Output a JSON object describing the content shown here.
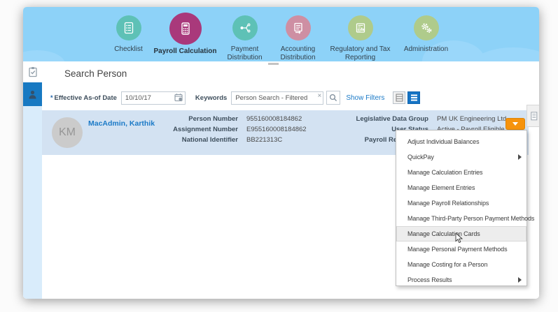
{
  "colors": {
    "header_blue": "#8DD2F8",
    "row_blue": "#D3E2F2",
    "accent_orange": "#F6930D",
    "link_blue": "#1B7AC7",
    "active_tile_blue": "#1779C2",
    "teal_circle": "#5EC1B6",
    "magenta_circle": "#A9397B",
    "pink_circle": "#CE8FA3",
    "green_circle": "#AFCB8B"
  },
  "nav": {
    "items": [
      {
        "label": "Checklist",
        "icon": "checklist-icon",
        "selected": false
      },
      {
        "label": "Payroll Calculation",
        "icon": "calculator-icon",
        "selected": true
      },
      {
        "label": "Payment Distribution",
        "icon": "payment-distribution-icon",
        "selected": false
      },
      {
        "label": "Accounting Distribution",
        "icon": "accounting-distribution-icon",
        "selected": false
      },
      {
        "label": "Regulatory and Tax Reporting",
        "icon": "regulatory-report-icon",
        "selected": false
      },
      {
        "label": "Administration",
        "icon": "gears-icon",
        "selected": false
      }
    ]
  },
  "sidebar": {
    "items": [
      {
        "icon": "tasks-clipboard-icon",
        "active": false
      },
      {
        "icon": "person-icon",
        "active": true
      }
    ]
  },
  "page": {
    "title": "Search Person"
  },
  "search": {
    "date_required_marker": "*",
    "date_label": "Effective As-of Date",
    "date_value": "10/10/17",
    "keywords_label": "Keywords",
    "keywords_value": "Person Search - Filtered",
    "clear_glyph": "×",
    "show_filters_label": "Show Filters"
  },
  "person": {
    "initials": "KM",
    "name": "MacAdmin, Karthik",
    "left_fields": [
      {
        "label": "Person Number",
        "value": "955160008184862"
      },
      {
        "label": "Assignment Number",
        "value": "E955160008184862"
      },
      {
        "label": "National Identifier",
        "value": "BB221313C"
      }
    ],
    "right_fields": [
      {
        "label": "Legislative Data Group",
        "value": "PM UK Engineering Ltd"
      },
      {
        "label": "User Status",
        "value": "Active - Payroll Eligible"
      },
      {
        "label": "Payroll Relationship Number",
        "value": ""
      }
    ]
  },
  "context_menu": {
    "items": [
      {
        "label": "Adjust Individual Balances",
        "has_submenu": false,
        "highlighted": false
      },
      {
        "label": "QuickPay",
        "has_submenu": true,
        "highlighted": false
      },
      {
        "label": "Manage Calculation Entries",
        "has_submenu": false,
        "highlighted": false
      },
      {
        "label": "Manage Element Entries",
        "has_submenu": false,
        "highlighted": false
      },
      {
        "label": "Manage Payroll Relationships",
        "has_submenu": false,
        "highlighted": false
      },
      {
        "label": "Manage Third-Party Person Payment Methods",
        "has_submenu": false,
        "highlighted": false
      },
      {
        "label": "Manage Calculation Cards",
        "has_submenu": false,
        "highlighted": true
      },
      {
        "label": "Manage Personal Payment Methods",
        "has_submenu": false,
        "highlighted": false
      },
      {
        "label": "Manage Costing for a Person",
        "has_submenu": false,
        "highlighted": false
      },
      {
        "label": "Process Results",
        "has_submenu": true,
        "highlighted": false
      }
    ]
  }
}
